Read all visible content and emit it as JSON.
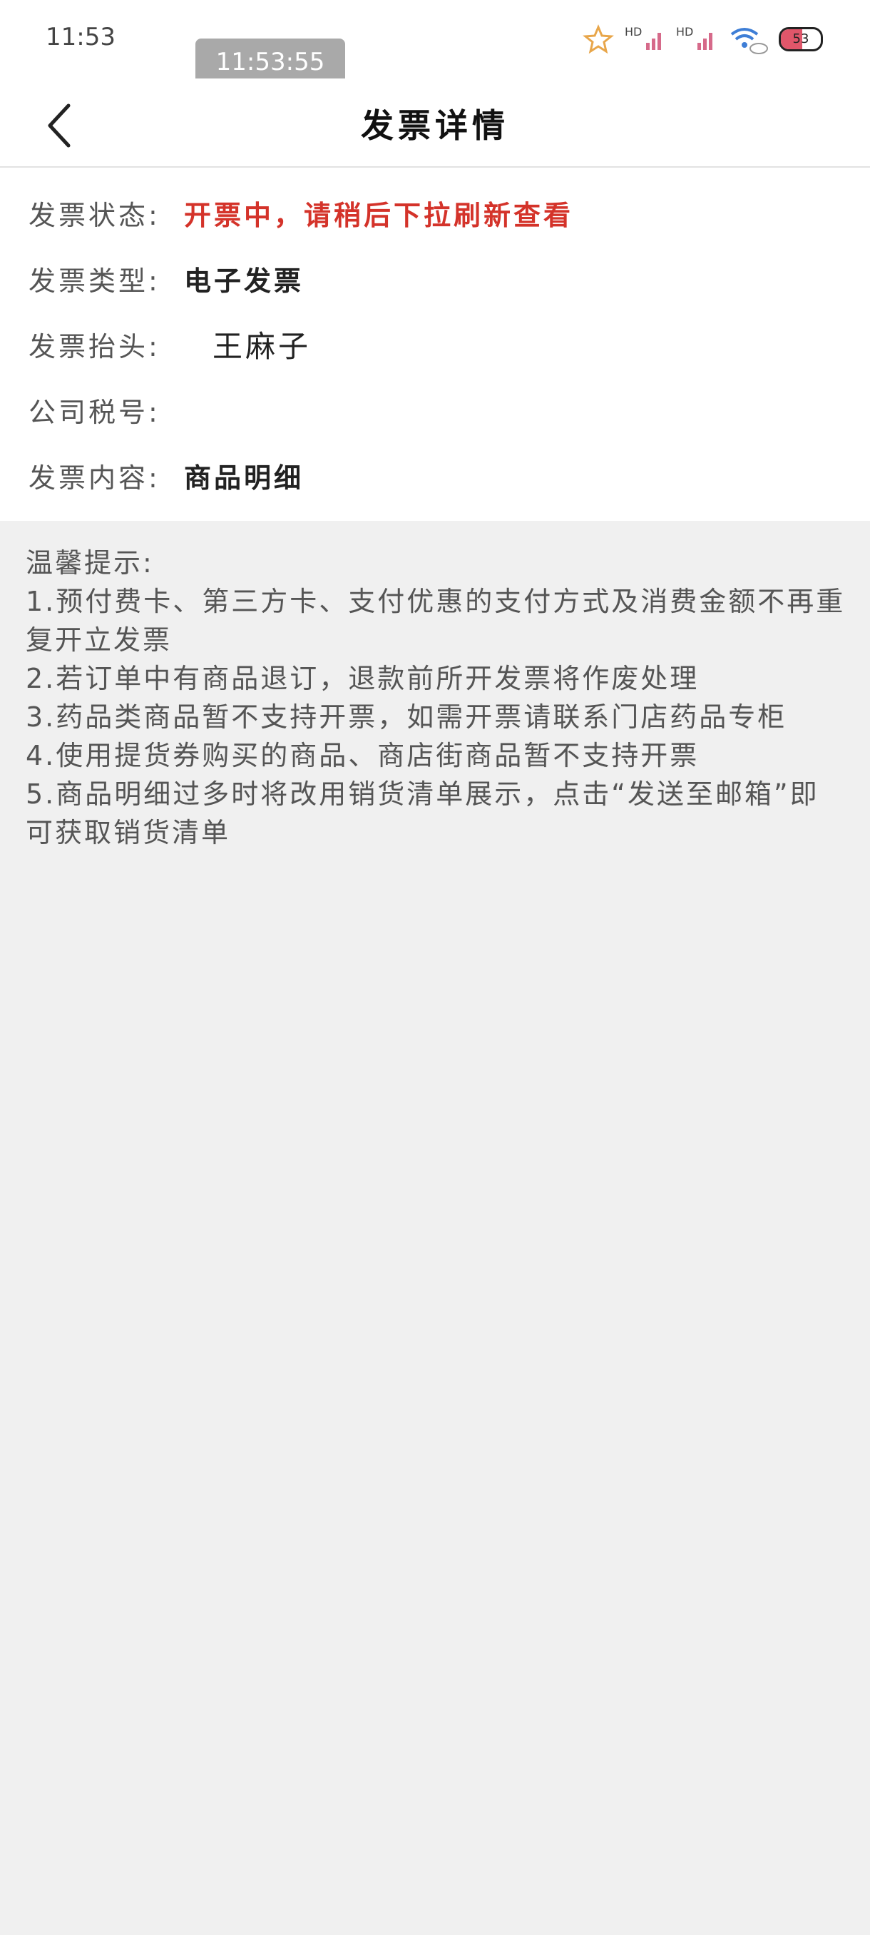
{
  "status_bar": {
    "time": "11:53",
    "time_pill": "11:53:55",
    "battery_level": 53,
    "battery_text": "53",
    "signal_label_1": "HD",
    "signal_label_2": "HD",
    "colors": {
      "battery_fill": "#e0566a",
      "star": "#e8a64a",
      "wifi": "#3e7ed6",
      "signal": "#d66a8a"
    }
  },
  "nav": {
    "title": "发票详情"
  },
  "invoice": {
    "rows": [
      {
        "label": "发票状态:",
        "value": "开票中，请稍后下拉刷新查看"
      },
      {
        "label": "发票类型:",
        "value": "电子发票"
      },
      {
        "label": "发票抬头:",
        "value": "王麻子"
      },
      {
        "label": "公司税号:",
        "value": ""
      },
      {
        "label": "发票内容:",
        "value": "商品明细"
      }
    ],
    "status_color": "#d4332a"
  },
  "tips": {
    "title": "温馨提示:",
    "items": [
      "1.预付费卡、第三方卡、支付优惠的支付方式及消费金额不再重复开立发票",
      "2.若订单中有商品退订，退款前所开发票将作废处理",
      "3.药品类商品暂不支持开票，如需开票请联系门店药品专柜",
      "4.使用提货券购买的商品、商店街商品暂不支持开票",
      "5.商品明细过多时将改用销货清单展示，点击“发送至邮箱”即可获取销货清单"
    ]
  }
}
